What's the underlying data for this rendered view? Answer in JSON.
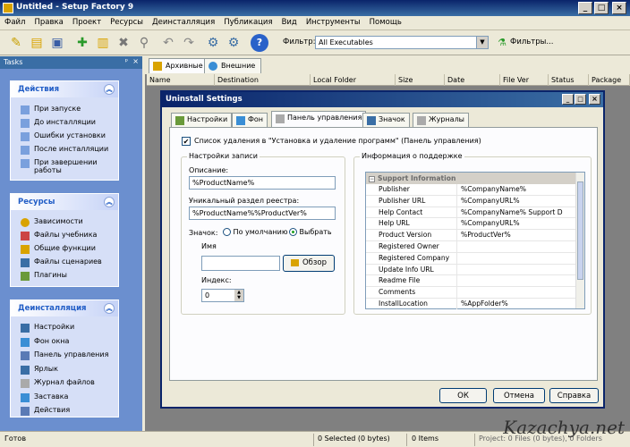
{
  "window": {
    "title": "Untitled - Setup Factory 9"
  },
  "menu": [
    "Файл",
    "Правка",
    "Проект",
    "Ресурсы",
    "Деинсталляция",
    "Публикация",
    "Вид",
    "Инструменты",
    "Помощь"
  ],
  "toolbar": {
    "filter_label": "Фильтр:",
    "filter_value": "All Executables",
    "filters_button": "Фильтры..."
  },
  "tasks": {
    "header": "Tasks",
    "groups": [
      {
        "title": "Действия",
        "items": [
          "При запуске",
          "До инсталляции",
          "Ошибки установки",
          "После инсталляции",
          "При завершении работы"
        ]
      },
      {
        "title": "Ресурсы",
        "items": [
          "Зависимости",
          "Файлы учебника",
          "Общие функции",
          "Файлы сценариев",
          "Плагины"
        ]
      },
      {
        "title": "Деинсталляция",
        "items": [
          "Настройки",
          "Фон окна",
          "Панель управления",
          "Ярлык",
          "Журнал файлов",
          "Заставка",
          "Действия"
        ]
      }
    ]
  },
  "main_tabs": [
    "Архивные",
    "Внешние"
  ],
  "columns": [
    "Name",
    "Destination",
    "Local Folder",
    "Size",
    "Date",
    "File Ver",
    "Status",
    "Package"
  ],
  "dialog": {
    "title": "Uninstall Settings",
    "tabs": [
      "Настройки",
      "Фон",
      "Панель управления",
      "Значок",
      "Журналы"
    ],
    "checkbox_label": "Список удаления в \"Установка и удаление программ\" (Панель управления)",
    "record_group": "Настройки записи",
    "description_label": "Описание:",
    "description_value": "%ProductName%",
    "registry_label": "Уникальный раздел реестра:",
    "registry_value": "%ProductName%%ProductVer%",
    "icon_label": "Значок:",
    "radio_default": "По умолчанию",
    "radio_select": "Выбрать",
    "name_label": "Имя",
    "name_value": "",
    "browse_button": "Обзор",
    "index_label": "Индекс:",
    "index_value": "0",
    "support_group": "Информация о поддержке",
    "support_section": "Support Information",
    "support_rows": [
      {
        "k": "Publisher",
        "v": "%CompanyName%"
      },
      {
        "k": "Publisher URL",
        "v": "%CompanyURL%"
      },
      {
        "k": "Help Contact",
        "v": "%CompanyName% Support D"
      },
      {
        "k": "Help URL",
        "v": "%CompanyURL%"
      },
      {
        "k": "Product Version",
        "v": "%ProductVer%"
      },
      {
        "k": "Registered Owner",
        "v": ""
      },
      {
        "k": "Registered Company",
        "v": ""
      },
      {
        "k": "Update Info URL",
        "v": ""
      },
      {
        "k": "Readme File",
        "v": ""
      },
      {
        "k": "Comments",
        "v": ""
      },
      {
        "k": "InstallLocation",
        "v": "%AppFolder%"
      }
    ],
    "ok": "ОК",
    "cancel": "Отмена",
    "help": "Справка"
  },
  "status": {
    "left": "Готов",
    "selected": "0 Selected (0 bytes)",
    "items": "0 Items",
    "project": "Project: 0 Files (0 bytes), 0 Folders"
  },
  "watermark": "Kazachya.net"
}
